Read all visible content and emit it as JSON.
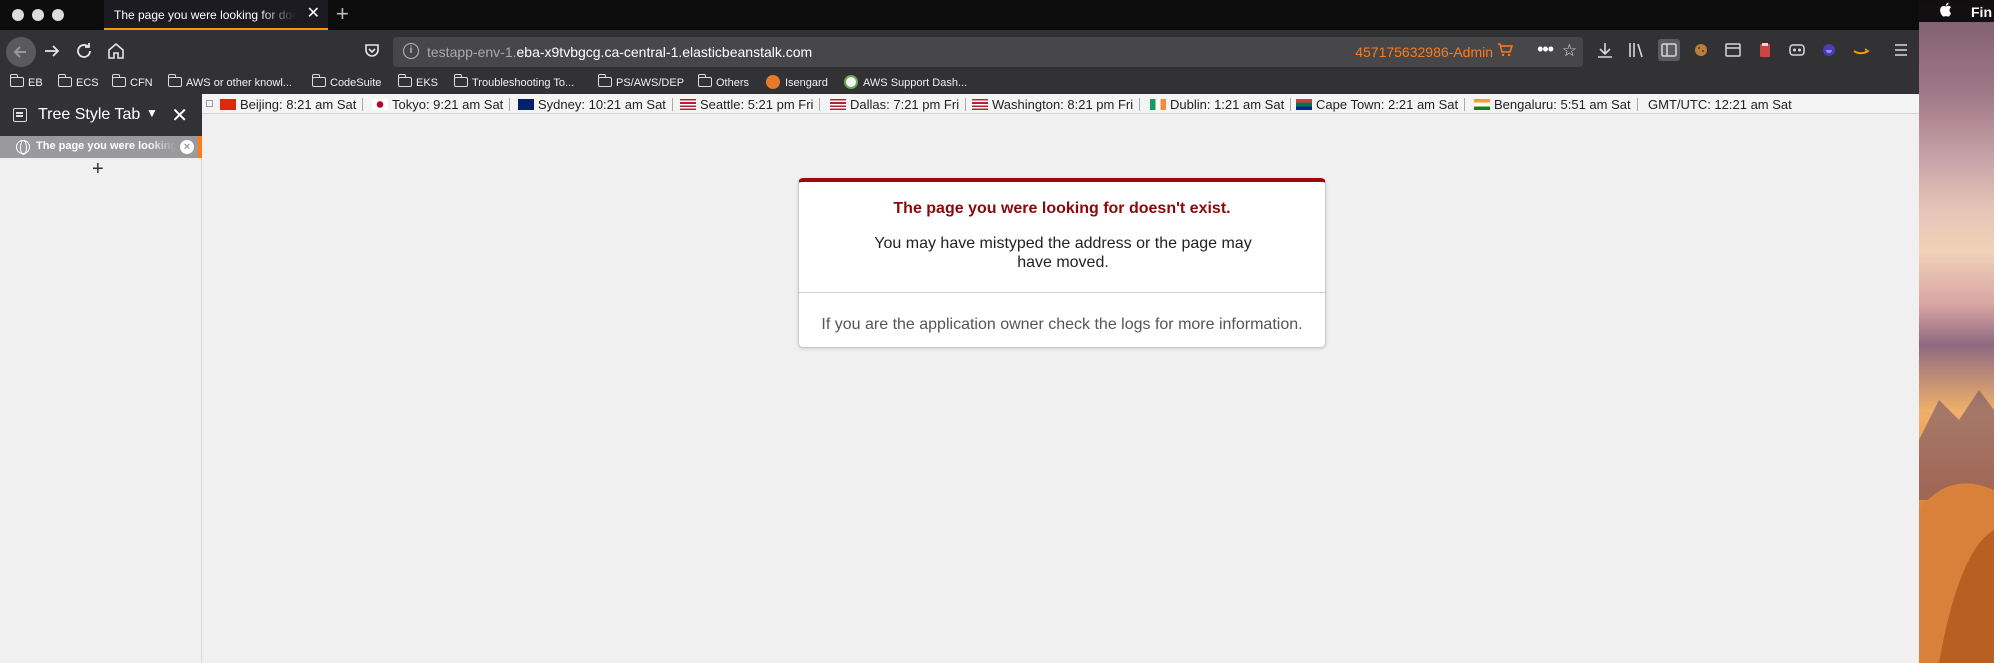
{
  "browser": {
    "tab": {
      "title": "The page you were looking for doesn't exist.",
      "close_glyph": "✕"
    },
    "new_tab_glyph": "+",
    "url": {
      "prefix": "testapp-env-1.",
      "domain": "eba-x9tvbgcg.ca-central-1.elasticbeanstalk.com"
    },
    "account_label": "457175632986-Admin",
    "more_glyph": "•••"
  },
  "bookmarks": [
    {
      "label": "EB",
      "type": "folder"
    },
    {
      "label": "ECS",
      "type": "folder"
    },
    {
      "label": "CFN",
      "type": "folder"
    },
    {
      "label": "AWS or other knowl...",
      "type": "folder"
    },
    {
      "label": "CodeSuite",
      "type": "folder"
    },
    {
      "label": "EKS",
      "type": "folder"
    },
    {
      "label": "Troubleshooting To...",
      "type": "folder"
    },
    {
      "label": "PS/AWS/DEP",
      "type": "folder"
    },
    {
      "label": "Others",
      "type": "folder"
    },
    {
      "label": "Isengard",
      "type": "site",
      "icon_color": "#e8792a"
    },
    {
      "label": "AWS Support Dash...",
      "type": "site",
      "icon_color": "#6aa84f"
    }
  ],
  "sidebar": {
    "title": "Tree Style Tab",
    "chevron": "⌄",
    "close_glyph": "✕",
    "tab_title": "The page you were looking for doesn't exist.",
    "tab_close_glyph": "×",
    "new_tab_glyph": "+"
  },
  "world_clock": [
    {
      "label": "Beijing: 8:21 am Sat",
      "flag": "cn"
    },
    {
      "label": "Tokyo: 9:21 am Sat",
      "flag": "jp"
    },
    {
      "label": "Sydney: 10:21 am Sat",
      "flag": "au"
    },
    {
      "label": "Seattle: 5:21 pm Fri",
      "flag": "us"
    },
    {
      "label": "Dallas: 7:21 pm Fri",
      "flag": "us"
    },
    {
      "label": "Washington: 8:21 pm Fri",
      "flag": "us"
    },
    {
      "label": "Dublin: 1:21 am Sat",
      "flag": "ie"
    },
    {
      "label": "Cape Town: 2:21 am Sat",
      "flag": "za"
    },
    {
      "label": "Bengaluru: 5:51 am Sat",
      "flag": "in"
    },
    {
      "label": "GMT/UTC: 12:21 am Sat",
      "flag": ""
    }
  ],
  "error": {
    "heading": "The page you were looking for doesn't exist.",
    "message": "You may have mistyped the address or the page may have moved.",
    "footer": "If you are the application owner check the logs for more information."
  },
  "desktop": {
    "menu_app": "Fin"
  },
  "colors": {
    "accent": "#ff9400",
    "error_red": "#9e0b0f",
    "account_orange": "#ff7a1a"
  },
  "icons": [
    "back-icon",
    "forward-icon",
    "reload-icon",
    "home-icon",
    "reader-icon",
    "info-icon",
    "cart-icon",
    "bookmark-star-icon",
    "download-icon",
    "library-icon",
    "sidebar-icon",
    "extension-icon",
    "menu-icon"
  ]
}
